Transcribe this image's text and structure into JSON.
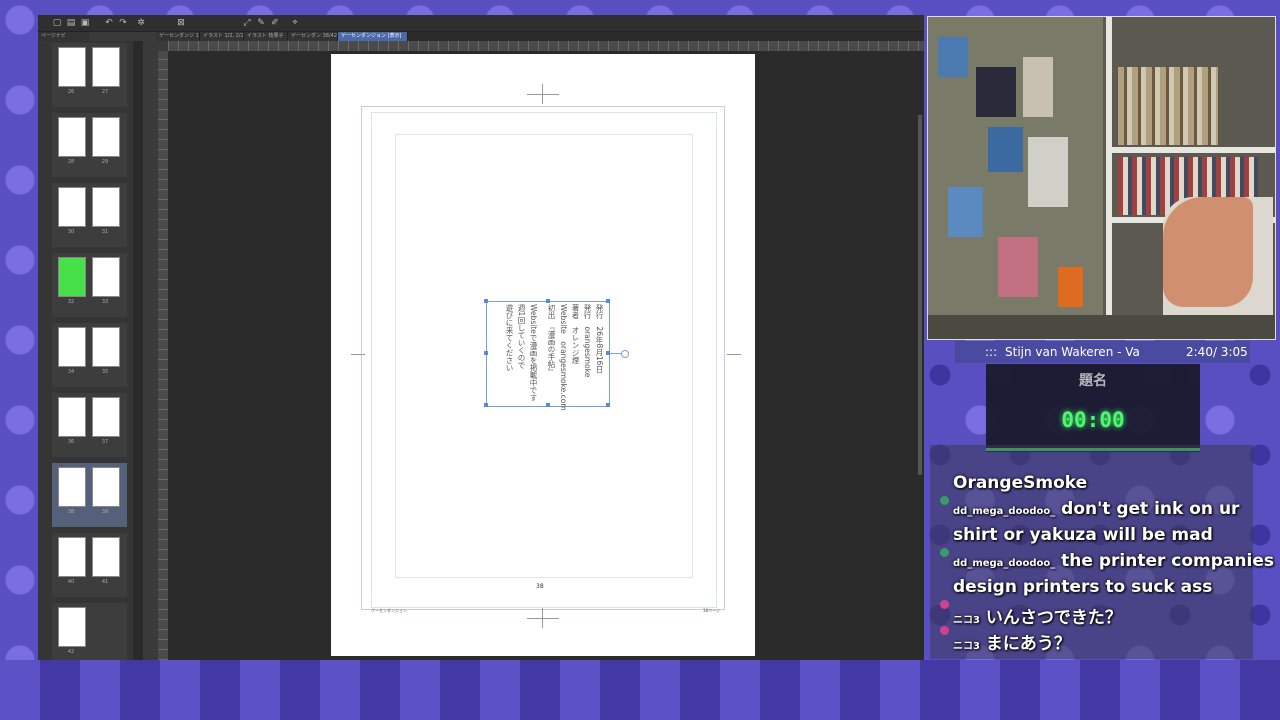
{
  "app": {
    "nav_tab": "ページナビ",
    "tabs": [
      "ゲーセンダンジ 1/42",
      "イラスト 1/2, 2/2",
      "イラスト 枝果子",
      "ゲーセンダン 38/42",
      "ゲーセンダンジョン [表示]"
    ],
    "pages": [
      {
        "left": "26",
        "right": "27"
      },
      {
        "left": "28",
        "right": "29"
      },
      {
        "left": "30",
        "right": "31"
      },
      {
        "left": "32",
        "right": "33"
      },
      {
        "left": "34",
        "right": "35"
      },
      {
        "left": "36",
        "right": "37"
      },
      {
        "left": "38",
        "right": "39"
      },
      {
        "left": "40",
        "right": "41"
      },
      {
        "left": "42",
        "right": ""
      }
    ],
    "page_number": "38",
    "footer_left": "ゲーセンダンジョン",
    "footer_right": "38ページ",
    "colophon": [
      "発行　26年8月16日",
      "発行　orangesmoke",
      "著者　オレンジ煙",
      "Website　orangesmoke.com",
      "初出　『漫画の手帖』",
      "Websiteで漫画を掲載中です",
      "週1回していくので",
      "遊びに来てください"
    ]
  },
  "music": {
    "prefix": ":::",
    "title": "Stijn van Wakeren - Va",
    "time": "2:40/ 3:05"
  },
  "timer": {
    "title": "題名",
    "value": "00:00"
  },
  "chat": [
    {
      "user": "",
      "text": "OrangeSmoke"
    },
    {
      "user": "dd_mega_doodoo_",
      "text": "don't get ink on ur"
    },
    {
      "user": "",
      "text": "shirt or yakuza will be mad"
    },
    {
      "user": "dd_mega_doodoo_",
      "text": "the printer companies"
    },
    {
      "user": "",
      "text": "design printers to suck ass"
    },
    {
      "user": "ニコ3",
      "text": "いんさつできた？"
    },
    {
      "user": "ニコ3",
      "text": "まにあう？"
    }
  ]
}
